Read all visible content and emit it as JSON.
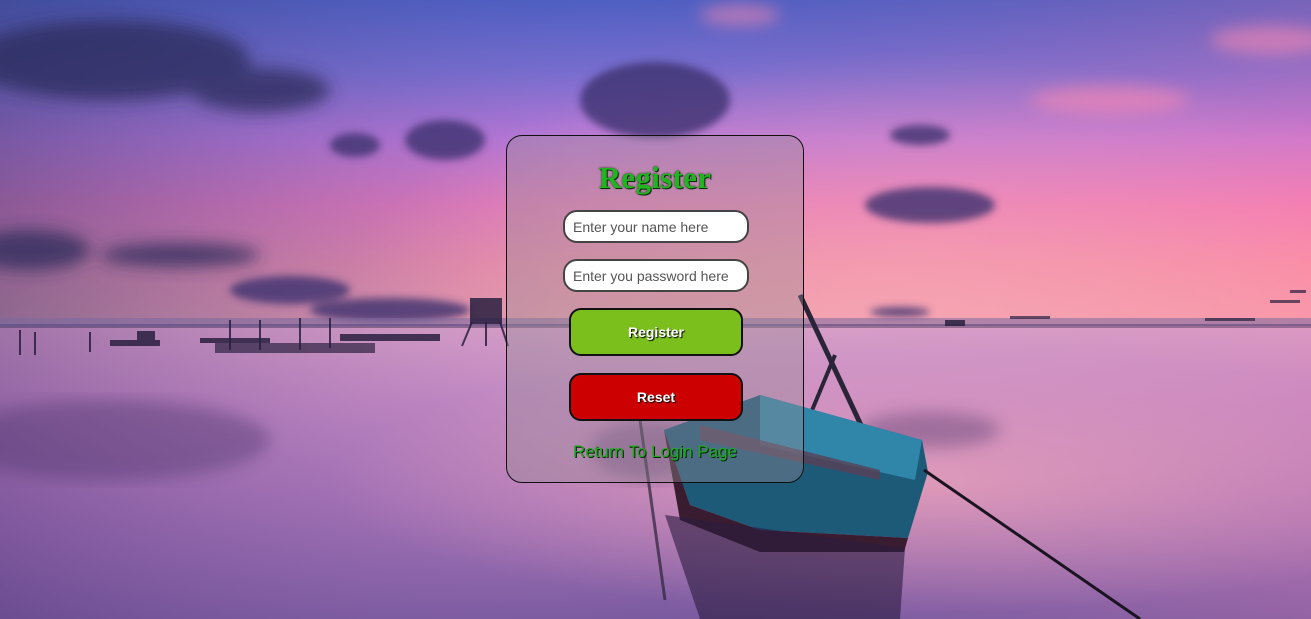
{
  "form": {
    "title": "Register",
    "name_placeholder": "Enter your name here",
    "password_placeholder": "Enter you password here",
    "register_label": "Register",
    "reset_label": "Reset",
    "return_link": "Return To Login Page"
  },
  "colors": {
    "title": "#1fb51f",
    "register_button": "#7bbf1c",
    "reset_button": "#cc0000",
    "link": "#1faa1f"
  }
}
